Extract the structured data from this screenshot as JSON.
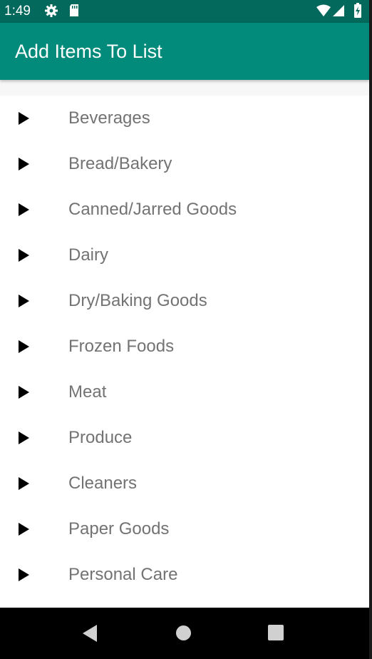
{
  "status_bar": {
    "time": "1:49",
    "icons": [
      "gear-icon",
      "sd-card-icon",
      "wifi-icon",
      "signal-icon",
      "battery-icon"
    ]
  },
  "app_bar": {
    "title": "Add Items To List"
  },
  "categories": [
    {
      "label": "Beverages"
    },
    {
      "label": "Bread/Bakery"
    },
    {
      "label": "Canned/Jarred Goods"
    },
    {
      "label": "Dairy"
    },
    {
      "label": "Dry/Baking Goods"
    },
    {
      "label": "Frozen Foods"
    },
    {
      "label": "Meat"
    },
    {
      "label": "Produce"
    },
    {
      "label": "Cleaners"
    },
    {
      "label": "Paper Goods"
    },
    {
      "label": "Personal Care"
    }
  ],
  "nav_bar": {
    "buttons": [
      "back-icon",
      "home-icon",
      "recents-icon"
    ]
  },
  "colors": {
    "status_bar": "#02695c",
    "app_bar": "#028a7b",
    "item_text": "#737373",
    "arrow": "#000000"
  }
}
